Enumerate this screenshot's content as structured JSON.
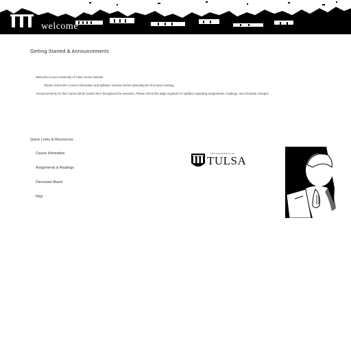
{
  "banner": {
    "welcome_text": "welcome"
  },
  "main": {
    "heading": "Getting Started & Announcements",
    "paragraphs": [
      "Welcome to your University of Tulsa course website.",
      "Please review the Course Information and Syllabus sections before attending the first class meeting.",
      "Announcements for this course will be posted here throughout the semester. Please check this page regularly for updates regarding assignments, readings, and schedule changes."
    ]
  },
  "quick_links": {
    "heading": "Quick Links & Resources",
    "items": [
      "Course Information",
      "Assignments & Readings",
      "Discussion Board",
      "Help"
    ]
  },
  "logo": {
    "subtext": "THE UNIVERSITY OF",
    "wordmark": "TULSA"
  },
  "colors": {
    "background": "#ffffff",
    "ink": "#000000"
  }
}
